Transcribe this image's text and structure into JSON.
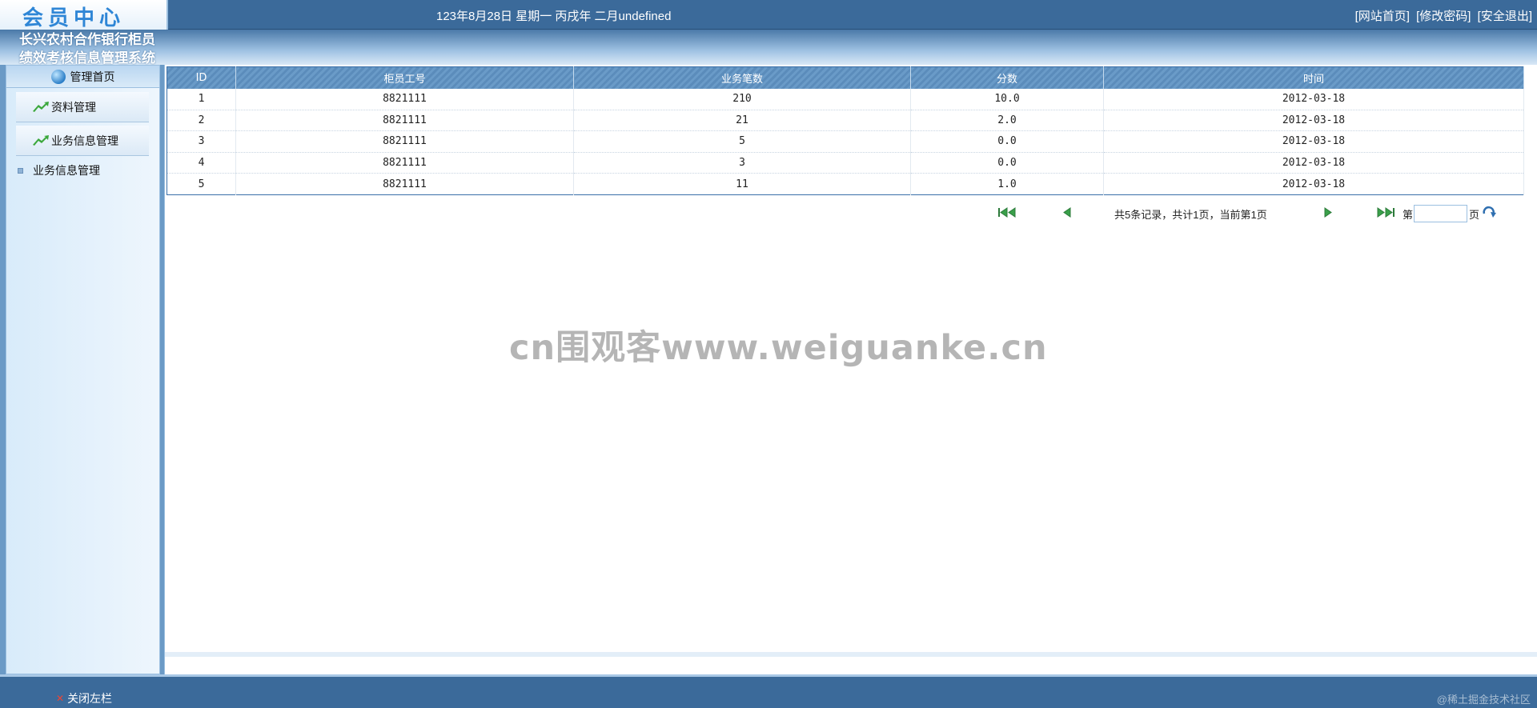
{
  "header": {
    "logo_text": "会员中心",
    "date_text": "123年8月28日 星期一 丙戌年 二月undefined",
    "links": [
      "[网站首页]",
      "[修改密码]",
      "[安全退出]"
    ]
  },
  "system_title": "长兴农村合作银行柜员绩效考核信息管理系统",
  "sidebar": {
    "home_label": "管理首页",
    "groups": [
      "资料管理",
      "业务信息管理"
    ],
    "sub_items": [
      "业务信息管理"
    ]
  },
  "table": {
    "headers": [
      "ID",
      "柜员工号",
      "业务笔数",
      "分数",
      "时间"
    ],
    "rows": [
      [
        "1",
        "8821111",
        "210",
        "10.0",
        "2012-03-18"
      ],
      [
        "2",
        "8821111",
        "21",
        "2.0",
        "2012-03-18"
      ],
      [
        "3",
        "8821111",
        "5",
        "0.0",
        "2012-03-18"
      ],
      [
        "4",
        "8821111",
        "3",
        "0.0",
        "2012-03-18"
      ],
      [
        "5",
        "8821111",
        "11",
        "1.0",
        "2012-03-18"
      ]
    ]
  },
  "pager": {
    "info": "共5条记录，共计1页，当前第1页",
    "page_prefix": "第",
    "page_suffix": "页",
    "page_input_value": ""
  },
  "footer": {
    "close_left_label": "关闭左栏",
    "corner_text": "@稀土掘金技术社区"
  },
  "watermark": "cn围观客www.weiguanke.cn",
  "colors": {
    "header_bg": "#3b6a9a",
    "table_header_bg": "#6a9bc8",
    "sidebar_bg": "#d8ebfa"
  },
  "icons": [
    "globe-icon",
    "green-arrow-icon",
    "first-page-icon",
    "prev-page-icon",
    "next-page-icon",
    "last-page-icon",
    "refresh-go-icon"
  ]
}
